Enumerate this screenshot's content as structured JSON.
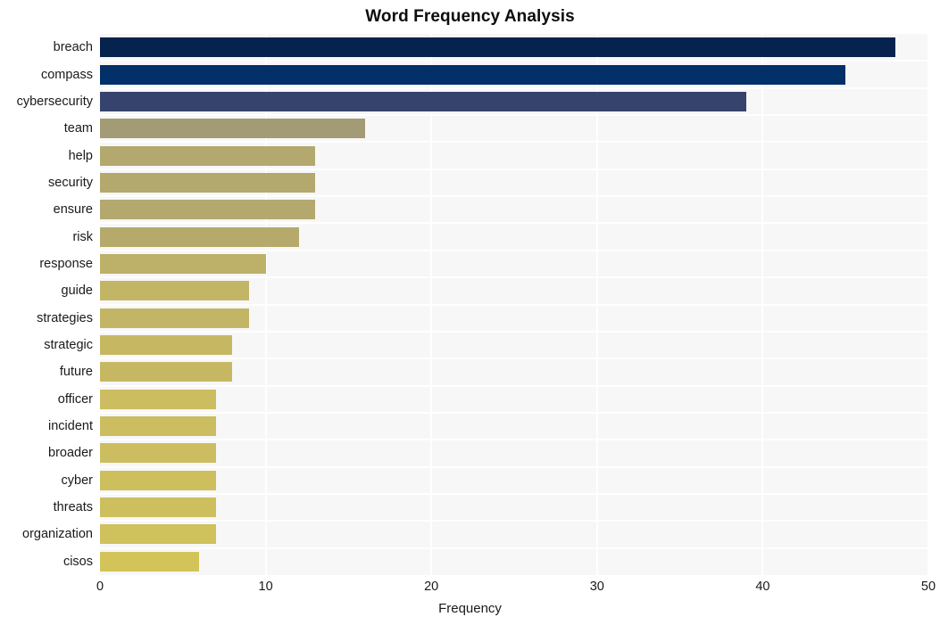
{
  "chart_data": {
    "type": "bar",
    "orientation": "horizontal",
    "title": "Word Frequency Analysis",
    "xlabel": "Frequency",
    "ylabel": "",
    "categories": [
      "breach",
      "compass",
      "cybersecurity",
      "team",
      "help",
      "security",
      "ensure",
      "risk",
      "response",
      "guide",
      "strategies",
      "strategic",
      "future",
      "officer",
      "incident",
      "broader",
      "cyber",
      "threats",
      "organization",
      "cisos"
    ],
    "values": [
      48,
      45,
      39,
      16,
      13,
      13,
      13,
      12,
      10,
      9,
      9,
      8,
      8,
      7,
      7,
      7,
      7,
      7,
      7,
      6
    ],
    "bar_colors": [
      "#06224e",
      "#033069",
      "#36436c",
      "#a39b75",
      "#b3a96f",
      "#b3a96f",
      "#b3a96f",
      "#b5aa6c",
      "#bdb068",
      "#c2b566",
      "#c2b566",
      "#c6b863",
      "#c6b863",
      "#cbbd60",
      "#cbbd60",
      "#cbbd60",
      "#cdbf5e",
      "#cdbf5e",
      "#cfc15c",
      "#d2c459"
    ],
    "xlim": [
      0,
      50
    ],
    "xticks": [
      0,
      10,
      20,
      30,
      40,
      50
    ],
    "xtick_labels": [
      "0",
      "10",
      "20",
      "30",
      "40",
      "50"
    ],
    "grid": true,
    "grid_color": "#ffffff",
    "plot_background": "#f7f7f7",
    "figure_background": "#ffffff",
    "legend": null
  }
}
